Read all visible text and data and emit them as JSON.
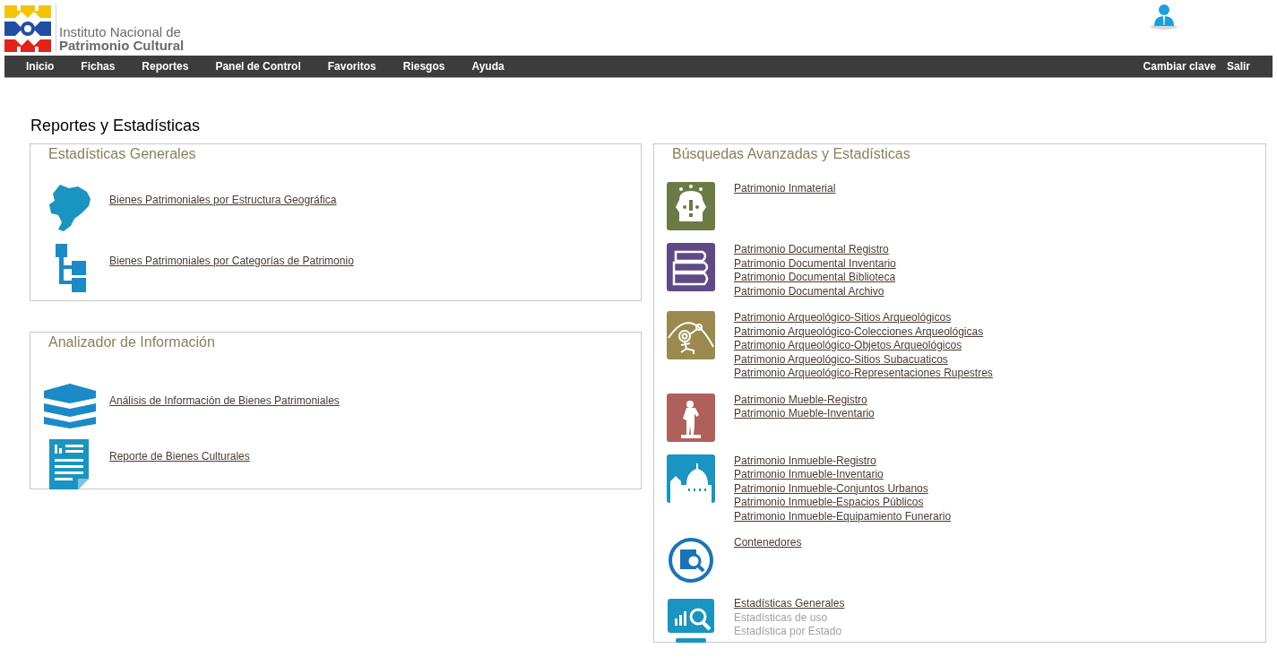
{
  "header": {
    "logo_line_1": "Instituto Nacional de",
    "logo_line_2": "Patrimonio Cultural"
  },
  "nav": {
    "items": [
      {
        "label": "Inicio"
      },
      {
        "label": "Fichas"
      },
      {
        "label": "Reportes"
      },
      {
        "label": "Panel de Control"
      },
      {
        "label": "Favoritos"
      },
      {
        "label": "Riesgos"
      },
      {
        "label": "Ayuda"
      }
    ],
    "right_items": [
      {
        "label": "Cambiar clave"
      },
      {
        "label": "Salir"
      }
    ]
  },
  "page_title": "Reportes y Estadísticas",
  "left_panels": [
    {
      "title": "Estadísticas Generales",
      "items": [
        {
          "kind": "map",
          "label": "Bienes Patrimoniales por Estructura Geográfica"
        },
        {
          "kind": "tree",
          "label": "Bienes Patrimoniales por Categorías de Patrimonio"
        }
      ]
    },
    {
      "title": "Analizador de Información",
      "items": [
        {
          "kind": "layers",
          "label": "Análisis de Información de Bienes Patrimoniales"
        },
        {
          "kind": "document",
          "label": "Reporte de Bienes Culturales"
        }
      ]
    }
  ],
  "right_panel": {
    "title": "Búsquedas Avanzadas y Estadísticas",
    "groups": [
      {
        "kind": "mask",
        "links": [
          {
            "label": "Patrimonio Inmaterial",
            "disabled": false
          }
        ]
      },
      {
        "kind": "books",
        "links": [
          {
            "label": "Patrimonio Documental Registro",
            "disabled": false
          },
          {
            "label": "Patrimonio Documental Inventario",
            "disabled": false
          },
          {
            "label": "Patrimonio Documental Biblioteca",
            "disabled": false
          },
          {
            "label": "Patrimonio Documental Archivo",
            "disabled": false
          }
        ]
      },
      {
        "kind": "petroglyph",
        "links": [
          {
            "label": "Patrimonio Arqueológico-Sitios Arqueológicos",
            "disabled": false
          },
          {
            "label": "Patrimonio Arqueológico-Colecciones Arqueológicas",
            "disabled": false
          },
          {
            "label": "Patrimonio Arqueológico-Objetos Arqueológicos",
            "disabled": false
          },
          {
            "label": "Patrimonio Arqueológico-Sitios Subacuaticos",
            "disabled": false
          },
          {
            "label": "Patrimonio Arqueológico-Representaciones Rupestres",
            "disabled": false
          }
        ]
      },
      {
        "kind": "statue",
        "links": [
          {
            "label": "Patrimonio Mueble-Registro",
            "disabled": false
          },
          {
            "label": "Patrimonio Mueble-Inventario",
            "disabled": false
          }
        ]
      },
      {
        "kind": "church",
        "links": [
          {
            "label": "Patrimonio Inmueble-Registro",
            "disabled": false
          },
          {
            "label": "Patrimonio Inmueble-Inventario",
            "disabled": false
          },
          {
            "label": "Patrimonio Inmueble-Conjuntos Urbanos",
            "disabled": false
          },
          {
            "label": "Patrimonio Inmueble-Espacios Públicos",
            "disabled": false
          },
          {
            "label": "Patrimonio Inmueble-Equipamiento Funerario",
            "disabled": false
          }
        ]
      },
      {
        "kind": "search-book",
        "links": [
          {
            "label": "Contenedores",
            "disabled": false
          }
        ]
      },
      {
        "kind": "monitor",
        "links": [
          {
            "label": "Estadísticas Generales",
            "disabled": false
          },
          {
            "label": "Estadísticas de uso",
            "disabled": true
          },
          {
            "label": "Estadística por Estado",
            "disabled": true
          }
        ]
      }
    ]
  }
}
